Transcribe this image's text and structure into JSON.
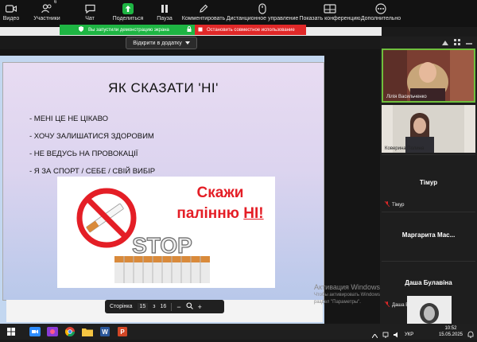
{
  "toolbar": {
    "items": [
      {
        "label": "Видео",
        "icon": "video-camera-icon"
      },
      {
        "label": "Участники",
        "icon": "participants-icon",
        "badge": "6"
      },
      {
        "label": "Чат",
        "icon": "chat-icon"
      },
      {
        "label": "Поделиться",
        "icon": "share-screen-icon"
      },
      {
        "label": "Пауза",
        "icon": "pause-icon"
      },
      {
        "label": "Комментировать",
        "icon": "annotate-pencil-icon"
      },
      {
        "label": "Дистанционное управление",
        "icon": "remote-control-mouse-icon"
      },
      {
        "label": "Показать конференцию",
        "icon": "show-meeting-icon"
      },
      {
        "label": "Дополнительно",
        "icon": "more-icon"
      }
    ]
  },
  "share_banner": {
    "status_text": "Вы запустили демонстрацию экрана",
    "stop_text": "Остановить совместное использование",
    "colors": {
      "green": "#1eb543",
      "red": "#e02828"
    }
  },
  "open_in_app": {
    "label": "Відкрити в додатку"
  },
  "slide": {
    "title": "ЯК СКАЗАТИ 'НІ'",
    "bullets": [
      "- МЕНІ ЦЕ НЕ ЦІКАВО",
      "- ХОЧУ ЗАЛИШАТИСЯ ЗДОРОВИМ",
      "- НЕ ВЕДУСЬ НА ПРОВОКАЦІЇ",
      "- Я ЗА СПОРТ / СЕБЕ / СВІЙ ВИБІР"
    ],
    "image_text_line1": "Скажи",
    "image_text_line2_a": "палінню ",
    "image_text_line2_b": "НІ!",
    "image_stop_word": "STOP"
  },
  "pager": {
    "label": "Сторінка",
    "current": "15",
    "of": "з",
    "total": "16",
    "minus": "−",
    "plus": "+"
  },
  "watermark": {
    "activation": "Активация Windows",
    "hint_line1": "Чтобы активировать Windows, перейдите в",
    "hint_line2": "раздел \"Параметры\"."
  },
  "participants": [
    {
      "name": "Лілія Васильченко",
      "type": "video"
    },
    {
      "name": "Коверина Полина",
      "type": "video"
    },
    {
      "name": "Тімур",
      "type": "name",
      "muted_label": "Тімур"
    },
    {
      "name": "Маргарита  Мас...",
      "type": "name"
    },
    {
      "name": "Даша Булавіна",
      "type": "name",
      "muted_label": "Даша Булавіна"
    },
    {
      "name": "",
      "type": "video"
    }
  ],
  "taskbar": {
    "time": "10:52",
    "date": "15.05.2025",
    "lang": "УКР"
  }
}
